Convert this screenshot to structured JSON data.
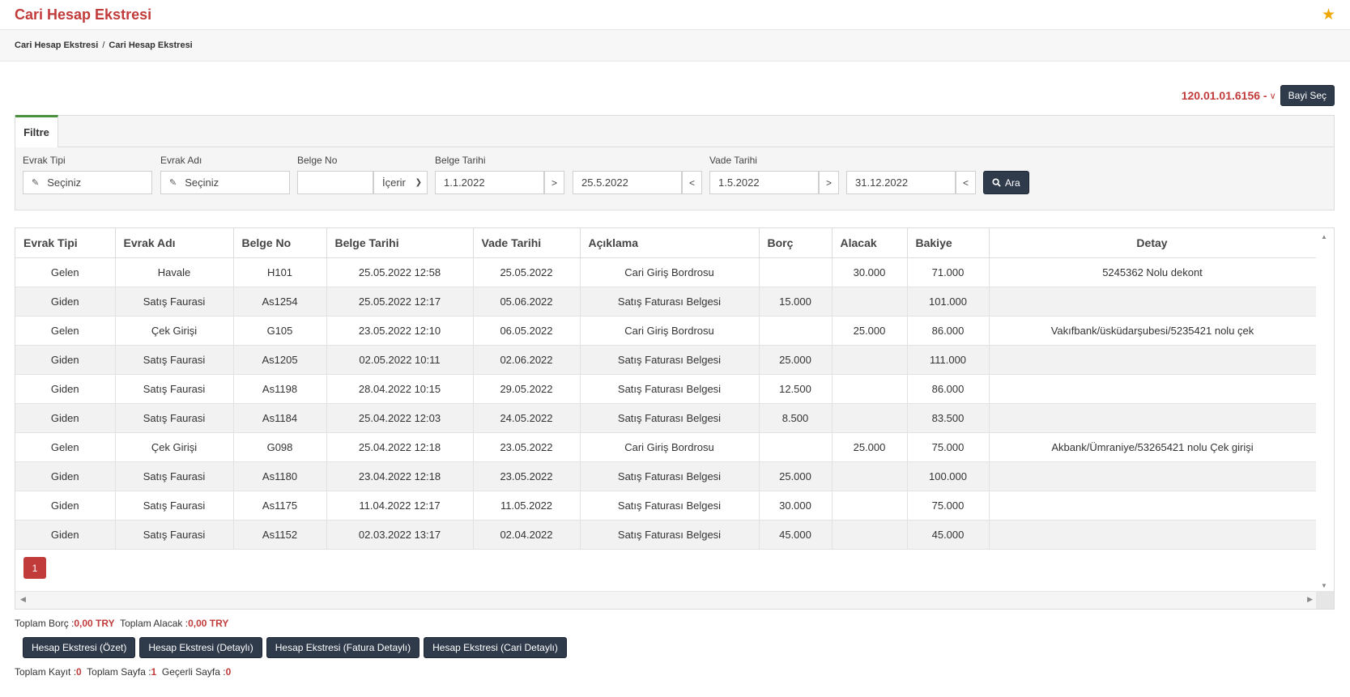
{
  "header": {
    "title": "Cari Hesap Ekstresi",
    "favorite_icon": "star-icon"
  },
  "breadcrumb": {
    "items": [
      "Cari Hesap Ekstresi",
      "Cari Hesap Ekstresi"
    ],
    "separator": "/"
  },
  "account": {
    "code": "120.01.01.6156 -",
    "chevron": "∨",
    "select_button": "Bayi Seç"
  },
  "filter": {
    "tab_label": "Filtre",
    "evrak_tipi": {
      "label": "Evrak Tipi",
      "value": "Seçiniz"
    },
    "evrak_adi": {
      "label": "Evrak Adı",
      "value": "Seçiniz"
    },
    "belge_no": {
      "label": "Belge No",
      "value": "",
      "operator": "İçerir"
    },
    "belge_tarihi": {
      "label": "Belge Tarihi",
      "from": "1.1.2022",
      "from_op": ">",
      "to": "25.5.2022",
      "to_op": "<"
    },
    "vade_tarihi": {
      "label": "Vade Tarihi",
      "from": "1.5.2022",
      "from_op": ">",
      "to": "31.12.2022",
      "to_op": "<"
    },
    "search_button": "Ara"
  },
  "table": {
    "columns": [
      "Evrak Tipi",
      "Evrak Adı",
      "Belge No",
      "Belge Tarihi",
      "Vade Tarihi",
      "Açıklama",
      "Borç",
      "Alacak",
      "Bakiye",
      "Detay"
    ],
    "rows": [
      [
        "Gelen",
        "Havale",
        "H101",
        "25.05.2022 12:58",
        "25.05.2022",
        "Cari Giriş Bordrosu",
        "",
        "30.000",
        "71.000",
        "5245362 Nolu dekont"
      ],
      [
        "Giden",
        "Satış Faurasi",
        "As1254",
        "25.05.2022 12:17",
        "05.06.2022",
        "Satış Faturası Belgesi",
        "15.000",
        "",
        "101.000",
        ""
      ],
      [
        "Gelen",
        "Çek Girişi",
        "G105",
        "23.05.2022 12:10",
        "06.05.2022",
        "Cari Giriş Bordrosu",
        "",
        "25.000",
        "86.000",
        "Vakıfbank/üsküdarşubesi/5235421 nolu çek"
      ],
      [
        "Giden",
        "Satış Faurasi",
        "As1205",
        "02.05.2022 10:11",
        "02.06.2022",
        "Satış Faturası Belgesi",
        "25.000",
        "",
        "111.000",
        ""
      ],
      [
        "Giden",
        "Satış Faurasi",
        "As1198",
        "28.04.2022 10:15",
        "29.05.2022",
        "Satış Faturası Belgesi",
        "12.500",
        "",
        "86.000",
        ""
      ],
      [
        "Giden",
        "Satış Faurasi",
        "As1184",
        "25.04.2022 12:03",
        "24.05.2022",
        "Satış Faturası Belgesi",
        "8.500",
        "",
        "83.500",
        ""
      ],
      [
        "Gelen",
        "Çek Girişi",
        "G098",
        "25.04.2022 12:18",
        "23.05.2022",
        "Cari Giriş Bordrosu",
        "",
        "25.000",
        "75.000",
        "Akbank/Ümraniye/53265421 nolu Çek girişi"
      ],
      [
        "Giden",
        "Satış Faurasi",
        "As1180",
        "23.04.2022 12:18",
        "23.05.2022",
        "Satış Faturası Belgesi",
        "25.000",
        "",
        "100.000",
        ""
      ],
      [
        "Giden",
        "Satış Faurasi",
        "As1175",
        "11.04.2022 12:17",
        "11.05.2022",
        "Satış Faturası Belgesi",
        "30.000",
        "",
        "75.000",
        ""
      ],
      [
        "Giden",
        "Satış Faurasi",
        "As1152",
        "02.03.2022 13:17",
        "02.04.2022",
        "Satış Faturası Belgesi",
        "45.000",
        "",
        "45.000",
        ""
      ]
    ]
  },
  "pagination": {
    "current_page": "1"
  },
  "totals": {
    "borc_label": "Toplam Borç :",
    "borc_value": "0,00 TRY",
    "alacak_label": "Toplam Alacak :",
    "alacak_value": "0,00 TRY"
  },
  "report_buttons": [
    "Hesap Ekstresi (Özet)",
    "Hesap Ekstresi (Detaylı)",
    "Hesap Ekstresi (Fatura Detaylı)",
    "Hesap Ekstresi (Cari Detaylı)"
  ],
  "summary": {
    "kayit_label": "Toplam Kayıt :",
    "kayit_value": "0",
    "sayfa_label": "Toplam Sayfa :",
    "sayfa_value": "1",
    "gecerli_label": "Geçerli Sayfa :",
    "gecerli_value": "0"
  },
  "colors": {
    "brand_red": "#c23b3b",
    "button_dark": "#2f3a4b",
    "tab_accent": "#4a8f3c",
    "star": "#f0a800"
  }
}
